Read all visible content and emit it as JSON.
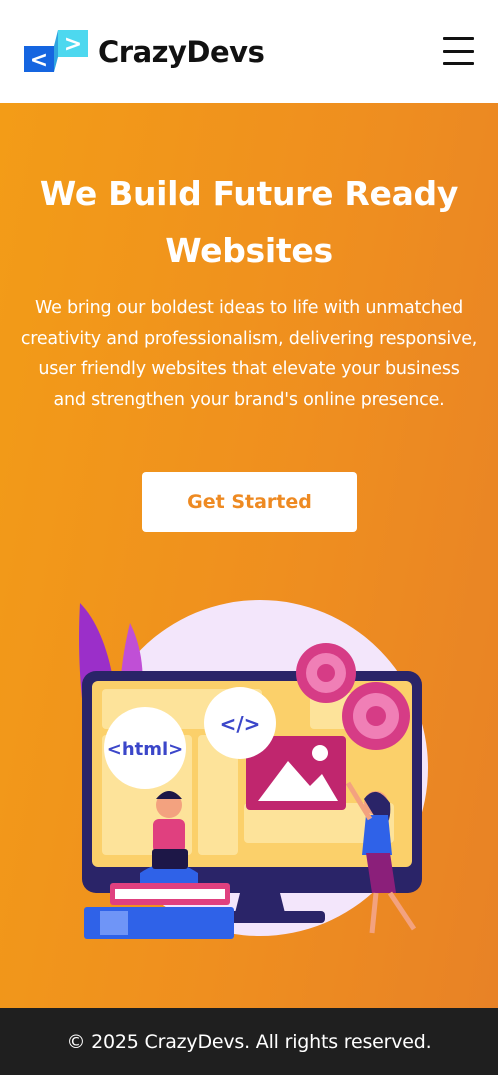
{
  "header": {
    "brand": "CrazyDevs",
    "logo_left_glyph": "<",
    "logo_right_glyph": ">",
    "menu_icon": "hamburger-menu-icon"
  },
  "hero": {
    "title_line1": "We Build Future Ready",
    "title_line2": "Websites",
    "description": "We bring our boldest ideas to life with unmatched creativity and professionalism, delivering responsive, user friendly websites that elevate your business and strengthen your brand's online presence.",
    "cta_label": "Get Started",
    "illustration": {
      "html_tag": "<html>",
      "code_tag": "</>"
    }
  },
  "footer": {
    "copyright": "© 2025 CrazyDevs. All rights reserved."
  },
  "colors": {
    "brand_blue": "#1565e0",
    "brand_cyan": "#4dd8ef",
    "hero_orange": "#f0931c",
    "cta_text": "#ee8a22",
    "footer_bg": "#1f1f1f"
  }
}
